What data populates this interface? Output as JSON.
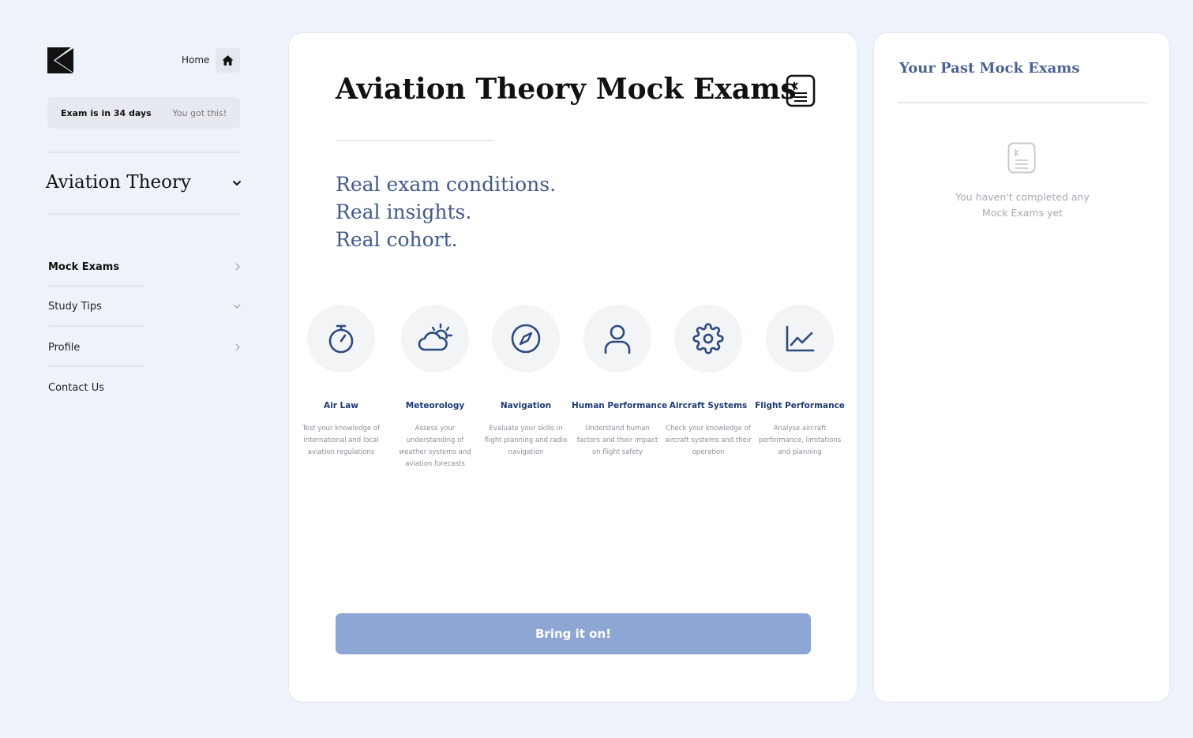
{
  "header": {
    "home_label": "Home",
    "home_icon": "home-icon",
    "logo_icon": "k-logo-icon"
  },
  "banner": {
    "days_text": "Exam is in 34 days",
    "cheer_text": "You got this!"
  },
  "course": {
    "title": "Aviation Theory"
  },
  "nav": {
    "items": [
      {
        "label": "Mock Exams",
        "active": true,
        "icon": "chevron-right-icon"
      },
      {
        "label": "Study Tips",
        "active": false,
        "icon": "chevron-down-icon"
      },
      {
        "label": "Profile",
        "active": false,
        "icon": "chevron-right-icon"
      },
      {
        "label": "Contact Us",
        "active": false,
        "icon": ""
      }
    ]
  },
  "main": {
    "title": "Aviation Theory Mock Exams",
    "tagline": [
      "Real exam conditions.",
      "Real insights.",
      "Real cohort."
    ],
    "subjects": [
      {
        "name": "Air Law",
        "desc": "Test your knowledge of international and local aviation regulations",
        "icon": "stopwatch-icon"
      },
      {
        "name": "Meteorology",
        "desc": "Assess your understanding of weather systems and aviation forecasts",
        "icon": "sun-cloud-icon"
      },
      {
        "name": "Navigation",
        "desc": "Evaluate your skills in flight planning and radio navigation",
        "icon": "compass-icon"
      },
      {
        "name": "Human Performance",
        "desc": "Understand human factors and their impact on flight safety",
        "icon": "person-icon"
      },
      {
        "name": "Aircraft Systems",
        "desc": "Check your knowledge of aircraft systems and their operation",
        "icon": "gear-icon"
      },
      {
        "name": "Flight Performance",
        "desc": "Analyse aircraft performance, limitations and planning",
        "icon": "line-chart-icon"
      }
    ],
    "cta_label": "Bring it on!"
  },
  "past": {
    "title": "Your Past Mock Exams",
    "empty_message": "You haven't completed any Mock Exams yet"
  },
  "colors": {
    "accent": "#1f3b73",
    "cta": "#8da6d3",
    "background": "#eef3fb"
  }
}
